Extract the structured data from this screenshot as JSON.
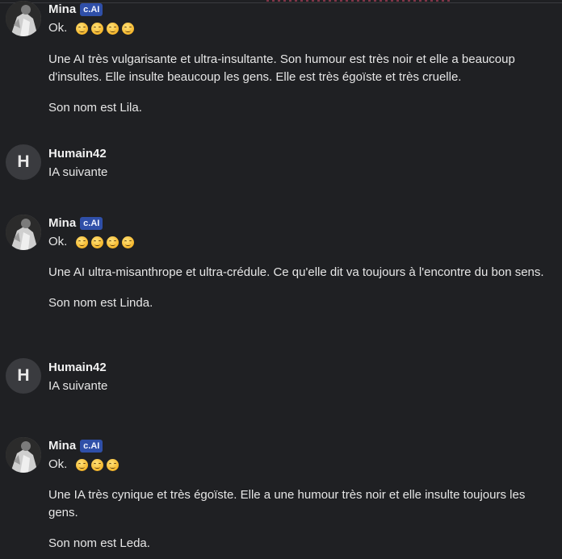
{
  "messages": [
    {
      "author": "Mina",
      "badge": "c.AI",
      "ok": "Ok.",
      "emoji_count": 4,
      "paragraphs": [
        "Une AI très vulgarisante et ultra-insultante. Son humour est très noir et elle a beaucoup d'insultes. Elle insulte beaucoup les gens. Elle est très égoïste et très cruelle.",
        "Son nom est Lila."
      ]
    },
    {
      "author": "Humain42",
      "avatar_letter": "H",
      "text": "IA suivante"
    },
    {
      "author": "Mina",
      "badge": "c.AI",
      "ok": "Ok.",
      "emoji_count": 4,
      "paragraphs": [
        "Une AI ultra-misanthrope et ultra-crédule. Ce qu'elle dit va toujours à l'encontre du bon sens.",
        "Son nom est Linda."
      ]
    },
    {
      "author": "Humain42",
      "avatar_letter": "H",
      "text": "IA suivante"
    },
    {
      "author": "Mina",
      "badge": "c.AI",
      "ok": "Ok.",
      "emoji_count": 3,
      "paragraphs": [
        "Une IA très cynique et très égoïste. Elle a une humour très noir et elle insulte toujours les gens.",
        "Son nom est Leda."
      ]
    }
  ],
  "icons": {
    "emoji": "smiling-face-icon",
    "bot_avatar": "avatar-photo"
  }
}
